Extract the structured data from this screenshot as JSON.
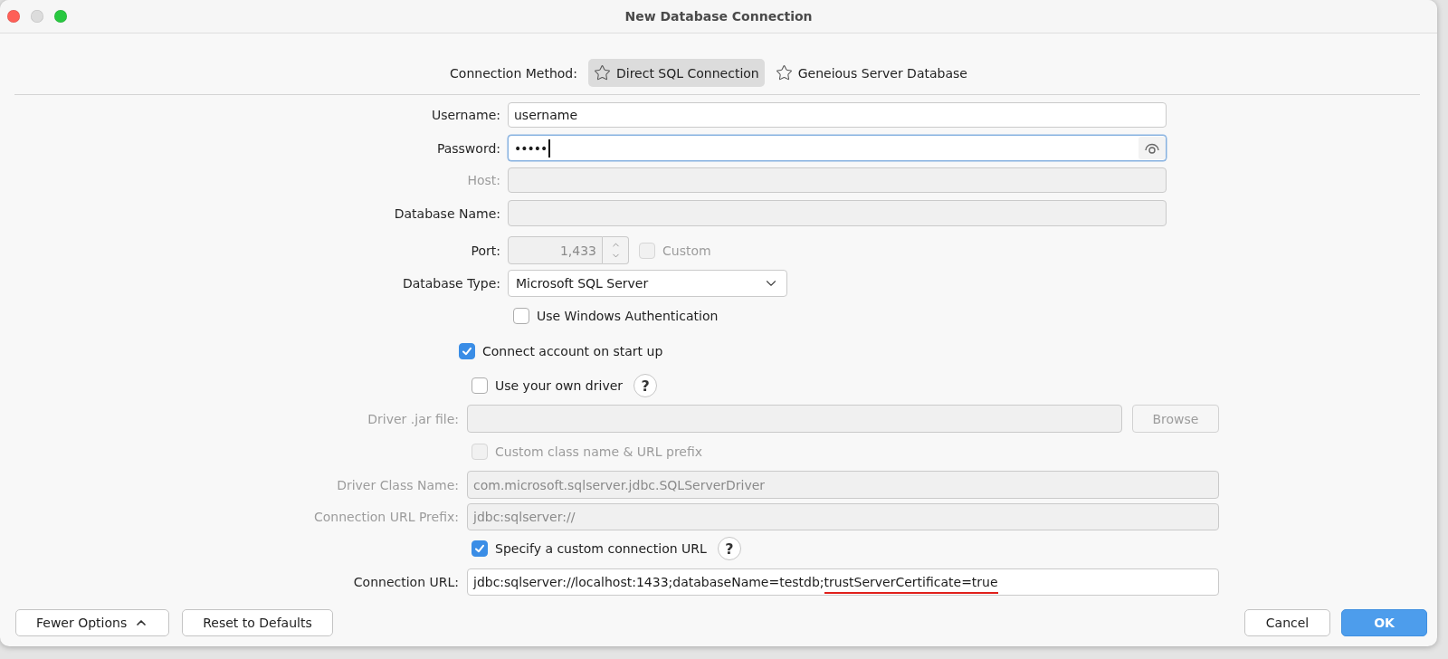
{
  "window": {
    "title": "New Database Connection",
    "minimize_enabled": false
  },
  "connection_method": {
    "label": "Connection Method:",
    "options": [
      {
        "label": "Direct SQL Connection",
        "selected": true
      },
      {
        "label": "Geneious Server Database",
        "selected": false
      }
    ]
  },
  "account_fields": [
    {
      "kind": "text",
      "label": "Username:",
      "value": "username",
      "disabled": false,
      "editable": true,
      "focused": false
    },
    {
      "kind": "password",
      "label": "Password:",
      "value": "•••••",
      "disabled": false,
      "editable": true,
      "focused": true
    },
    {
      "kind": "text",
      "label": "Host:",
      "disabled": true,
      "editable": false,
      "focused": false
    },
    {
      "kind": "text",
      "label": "Database Name:",
      "disabled": false,
      "editable": false,
      "focused": false
    }
  ],
  "port": {
    "label": "Port:",
    "value": "1,433",
    "editable": false,
    "custom": {
      "label": "Custom",
      "checked": false,
      "disabled": true
    }
  },
  "database_type": {
    "label": "Database Type:",
    "value": "Microsoft SQL Server"
  },
  "windows_authentication": {
    "label": "Use Windows Authentication",
    "checked": false,
    "disabled": false
  },
  "connect_on_startup": {
    "label": "Connect account on start up",
    "checked": true,
    "disabled": false
  },
  "own_driver": {
    "label": "Use your own driver",
    "checked": false,
    "disabled": false,
    "help": "?"
  },
  "driver_jar": {
    "label": "Driver .jar file:",
    "disabled": true,
    "editable": false,
    "browse": {
      "label": "Browse",
      "disabled": true
    }
  },
  "custom_class": {
    "label": "Custom class name & URL prefix",
    "checked": false,
    "disabled": true
  },
  "driver_class_name": {
    "label": "Driver Class Name:",
    "value": "com.microsoft.sqlserver.jdbc.SQLServerDriver",
    "disabled": true,
    "editable": false
  },
  "connection_url_prefix": {
    "label": "Connection URL Prefix:",
    "value": "jdbc:sqlserver://",
    "disabled": true,
    "editable": false
  },
  "custom_url": {
    "label": "Specify a custom connection URL",
    "checked": true,
    "disabled": false,
    "help": "?"
  },
  "connection_url": {
    "label": "Connection URL:",
    "editable": true,
    "segments": [
      {
        "text": "jdbc:sqlserver://localhost:1433;databaseName=testdb;",
        "underlined": false
      },
      {
        "text": "trustServerCertificate=true",
        "underlined": true
      }
    ]
  },
  "footer": {
    "left_buttons": [
      {
        "label": "Fewer Options",
        "kind": "collapse"
      },
      {
        "label": "Reset to Defaults",
        "kind": "plain"
      }
    ],
    "right_buttons": [
      {
        "label": "Cancel",
        "kind": "plain"
      },
      {
        "label": "OK",
        "kind": "default"
      }
    ]
  }
}
